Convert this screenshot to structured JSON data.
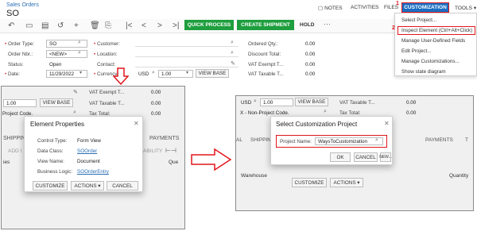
{
  "breadcrumb": "Sales Orders",
  "page_title": "SO",
  "header_links": [
    "NOTES",
    "ACTIVITIES",
    "FILES",
    "CUSTOMIZATION",
    "TOOLS"
  ],
  "toolbar": {
    "quick_process": "QUICK PROCESS",
    "create_shipment": "CREATE SHIPMENT",
    "hold": "HOLD",
    "more": "···"
  },
  "form_left": {
    "order_type_label": "Order Type:",
    "order_type_value": "SO",
    "order_nbr_label": "Order Nbr.:",
    "order_nbr_value": "<NEW>",
    "status_label": "Status:",
    "status_value": "Open",
    "date_label": "Date:",
    "date_value": "11/29/2022"
  },
  "form_mid": {
    "customer_label": "Customer:",
    "location_label": "Location:",
    "contact_label": "Contact:",
    "currency_label": "Currency:",
    "currency_value": "USD",
    "rate_value": "1.00",
    "view_base": "VIEW BASE"
  },
  "form_right": {
    "rows": [
      {
        "label": "Ordered Qty.:",
        "value": "0.00"
      },
      {
        "label": "Discount Total:",
        "value": "0.00"
      },
      {
        "label": "VAT Exempt T...",
        "value": "0.00"
      },
      {
        "label": "VAT Taxable T...",
        "value": "0.00"
      }
    ]
  },
  "menu": {
    "items": [
      "Select Project...",
      "Inspect Element (Ctrl+Alt+Click)",
      "Manage User-Defined Fields",
      "Edit Project...",
      "Manage Customizations...",
      "Show state diagram"
    ]
  },
  "badges": {
    "one": "1",
    "two": "2"
  },
  "left_panel": {
    "rate": "1.00",
    "view_base": "VIEW BASE",
    "project_code": "Project Code.",
    "right_rows": [
      {
        "label": "VAT Exempt T...",
        "value": "0.00"
      },
      {
        "label": "VAT Taxable T...",
        "value": "0.00"
      },
      {
        "label": "Tax Total:",
        "value": "0.00"
      }
    ],
    "tabs_left": "SHIPPING",
    "tabs_right": "PAYMENTS",
    "add": "ADD I",
    "ability": "ABILITY",
    "que": "Que",
    "row_label": "ies"
  },
  "element_dialog": {
    "title": "Element Properties",
    "fields": [
      {
        "label": "Control Type:",
        "value": "Form View",
        "link": false
      },
      {
        "label": "Data Class:",
        "value": "SOOrder",
        "link": true
      },
      {
        "label": "View Name:",
        "value": "Document",
        "link": false
      },
      {
        "label": "Business Logic:",
        "value": "SOOrderEntry",
        "link": true
      }
    ],
    "customize": "CUSTOMIZE",
    "actions": "ACTIONS ▾",
    "cancel": "CANCEL"
  },
  "right_panel": {
    "currency": "USD",
    "rate": "1.00",
    "view_base": "VIEW BASE",
    "project_row": "X - Non-Project Code.",
    "right_rows": [
      {
        "label": "VAT Taxable T...",
        "value": "0.00"
      },
      {
        "label": "Tax Total:",
        "value": "0.00"
      }
    ],
    "tabs": [
      "AL",
      "SHIPPING",
      "PAYMENTS",
      "T"
    ],
    "warehouse": "Warehouse",
    "quantity": "Quantity"
  },
  "select_dialog": {
    "title": "Select Customization Project",
    "project_name_label": "Project Name:",
    "project_name_value": "WaysToCustomization",
    "ok": "OK",
    "cancel": "CANCEL",
    "new": "NEW...",
    "customize": "CUSTOMIZE",
    "actions": "ACTIONS ▾"
  }
}
